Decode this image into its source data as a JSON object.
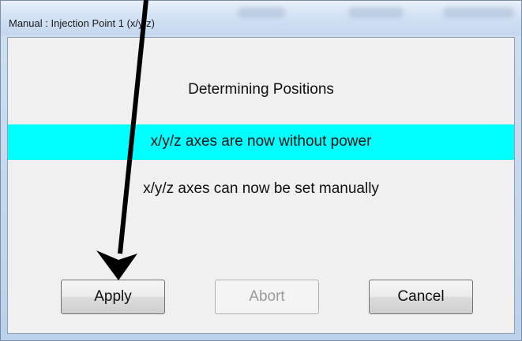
{
  "window": {
    "title": "Manual : Injection Point 1 (x/y/z)"
  },
  "dialog": {
    "heading": "Determining Positions",
    "status_message": "x/y/z axes are now without power",
    "info_message": "x/y/z axes can now be set manually",
    "highlight_color": "#00ffff"
  },
  "buttons": {
    "apply_label": "Apply",
    "abort_label": "Abort",
    "cancel_label": "Cancel",
    "abort_enabled": false
  },
  "annotation": {
    "arrow_color": "#000000",
    "arrow_target": "apply-button"
  }
}
